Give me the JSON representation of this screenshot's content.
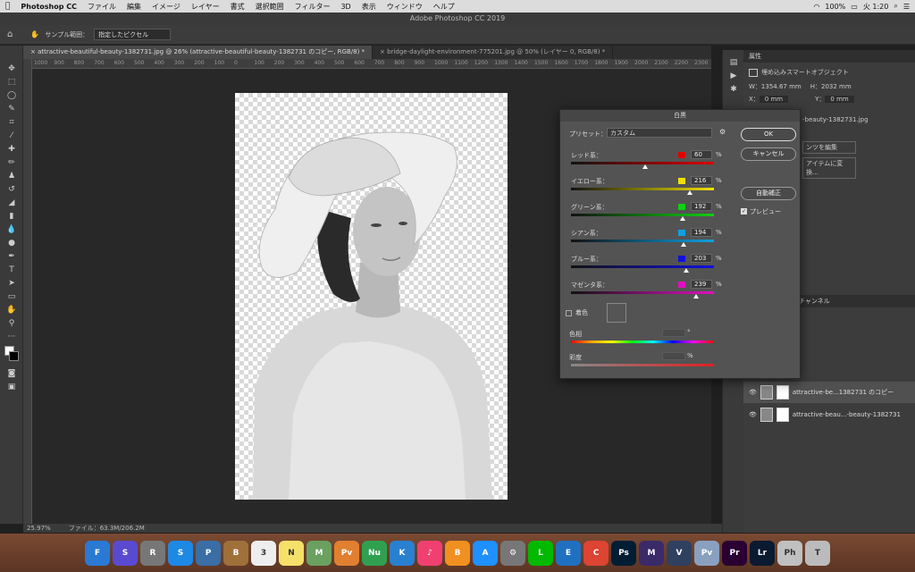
{
  "menubar": {
    "apple": "",
    "app": "Photoshop CC",
    "items": [
      "ファイル",
      "編集",
      "イメージ",
      "レイヤー",
      "書式",
      "選択範囲",
      "フィルター",
      "3D",
      "表示",
      "ウィンドウ",
      "ヘルプ"
    ],
    "battery": "100%",
    "time": "火 1:20"
  },
  "window_title": "Adobe Photoshop CC 2019",
  "options": {
    "sample_label": "サンプル範囲：",
    "sample_value": "指定したピクセル"
  },
  "tabs": [
    "attractive-beautiful-beauty-1382731.jpg @ 26% (attractive-beautiful-beauty-1382731 のコピー, RGB/8) *",
    "bridge-daylight-environment-775201.jpg @ 50% (レイヤー 0, RGB/8) *"
  ],
  "ruler": [
    "1000",
    "900",
    "800",
    "700",
    "600",
    "500",
    "400",
    "300",
    "200",
    "100",
    "0",
    "100",
    "200",
    "300",
    "400",
    "500",
    "600",
    "700",
    "800",
    "900",
    "1000",
    "1100",
    "1200",
    "1300",
    "1400",
    "1500",
    "1600",
    "1700",
    "1800",
    "1900",
    "2000",
    "2100",
    "2200",
    "2300"
  ],
  "status": {
    "zoom": "25.97%",
    "file": "ファイル：63.3M/206.2M"
  },
  "dialog": {
    "title": "白黒",
    "preset_label": "プリセット：",
    "preset_value": "カスタム",
    "sliders": [
      {
        "label": "レッド系：",
        "value": "60",
        "color": "#e00000"
      },
      {
        "label": "イエロー系：",
        "value": "216",
        "color": "#f0e000"
      },
      {
        "label": "グリーン系：",
        "value": "192",
        "color": "#10d010"
      },
      {
        "label": "シアン系：",
        "value": "194",
        "color": "#10a0e0"
      },
      {
        "label": "ブルー系：",
        "value": "203",
        "color": "#1010e0"
      },
      {
        "label": "マゼンタ系：",
        "value": "239",
        "color": "#e010c0"
      }
    ],
    "pct": "%",
    "tint_label": "着色",
    "hue_label": "色相",
    "hue_unit": "°",
    "sat_label": "彩度",
    "ok": "OK",
    "cancel": "キャンセル",
    "auto": "自動補正",
    "preview": "プレビュー"
  },
  "properties": {
    "tab": "属性",
    "type": "埋め込みスマートオブジェクト",
    "w_label": "W：",
    "w_value": "1354.67 mm",
    "h_label": "H：",
    "h_value": "2032 mm",
    "x_label": "X：",
    "x_value": "0 mm",
    "y_label": "Y：",
    "y_value": "0 mm",
    "file": "-beauty-1382731.jpg",
    "embed": "ンツを編集",
    "convert": "アイテムに変換..."
  },
  "layers": {
    "tab": "チャンネル",
    "items": [
      {
        "name": "attractive-be...1382731 のコピー"
      },
      {
        "name": "attractive-beau...-beauty-1382731"
      }
    ]
  },
  "dock": [
    {
      "label": "F",
      "color": "#2a7ad5"
    },
    {
      "label": "S",
      "color": "#5a4ad0"
    },
    {
      "label": "R",
      "color": "#777"
    },
    {
      "label": "S",
      "color": "#1e88e5"
    },
    {
      "label": "P",
      "color": "#3a6ea5"
    },
    {
      "label": "B",
      "color": "#a0703a"
    },
    {
      "label": "3",
      "color": "#eeeeee"
    },
    {
      "label": "N",
      "color": "#f5e06a"
    },
    {
      "label": "M",
      "color": "#6aa060"
    },
    {
      "label": "Pv",
      "color": "#e08030"
    },
    {
      "label": "Nu",
      "color": "#30a050"
    },
    {
      "label": "K",
      "color": "#2a80d0"
    },
    {
      "label": "♪",
      "color": "#f04070"
    },
    {
      "label": "B",
      "color": "#f09020"
    },
    {
      "label": "A",
      "color": "#1e90ff"
    },
    {
      "label": "⚙",
      "color": "#777"
    },
    {
      "label": "L",
      "color": "#00b900"
    },
    {
      "label": "E",
      "color": "#2070c0"
    },
    {
      "label": "C",
      "color": "#dd4433"
    },
    {
      "label": "Ps",
      "color": "#001d34"
    },
    {
      "label": "M",
      "color": "#3a2a6a"
    },
    {
      "label": "V",
      "color": "#304060"
    },
    {
      "label": "Pv",
      "color": "#8aa0c0"
    },
    {
      "label": "Pr",
      "color": "#2a0033"
    },
    {
      "label": "Lr",
      "color": "#0a1a30"
    },
    {
      "label": "Ph",
      "color": "#c0c0c0"
    },
    {
      "label": "T",
      "color": "#bbbbbb"
    }
  ]
}
